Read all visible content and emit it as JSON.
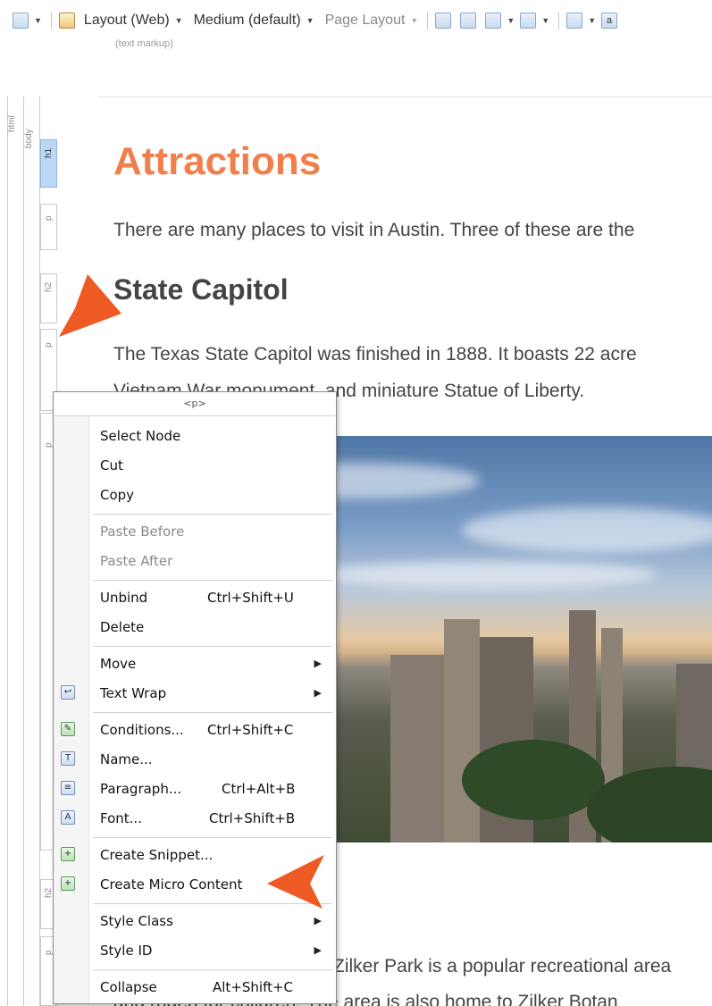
{
  "toolbar": {
    "layout_label": "Layout (Web)",
    "size_label": "Medium (default)",
    "page_layout_label": "Page Layout",
    "markup_note": "(text markup)",
    "icons": [
      "view-icon",
      "structure-icon",
      "preview-icon",
      "insert-table-icon",
      "insert-image-icon",
      "link-icon",
      "text-icon",
      "font-icon"
    ]
  },
  "structure": {
    "html_tag": "html",
    "body_tag": "body",
    "nodes": [
      {
        "label": "h1",
        "active": true
      },
      {
        "label": "p",
        "active": false
      },
      {
        "label": "h2",
        "active": false
      },
      {
        "label": "p",
        "active": false
      },
      {
        "label": "p",
        "active": false
      },
      {
        "label": "h2",
        "active": false
      },
      {
        "label": "p",
        "active": false
      }
    ]
  },
  "document": {
    "heading": "Attractions",
    "intro": "There are many places to visit in Austin. Three of these are the",
    "subheading": "State Capitol",
    "capitol_line1": "The Texas State Capitol was finished in 1888. It boasts 22 acre",
    "capitol_line2": "Vietnam War monument, and miniature Statue of Liberty.",
    "park_line1": "Zilker Park is a popular recreational area",
    "park_line2": "and rodeo for children. The area is also home to Zilker Botan"
  },
  "menu": {
    "title": "<p>",
    "items": [
      {
        "label": "Select Node",
        "shortcut": "",
        "enabled": true
      },
      {
        "label": "Cut",
        "shortcut": "",
        "enabled": true
      },
      {
        "label": "Copy",
        "shortcut": "",
        "enabled": true
      },
      {
        "label": "Paste Before",
        "shortcut": "",
        "enabled": false
      },
      {
        "label": "Paste After",
        "shortcut": "",
        "enabled": false
      },
      {
        "label": "Unbind",
        "shortcut": "Ctrl+Shift+U",
        "enabled": true
      },
      {
        "label": "Delete",
        "shortcut": "",
        "enabled": true
      },
      {
        "label": "Move",
        "shortcut": "",
        "enabled": true,
        "submenu": true
      },
      {
        "label": "Text Wrap",
        "shortcut": "",
        "enabled": true,
        "submenu": true,
        "icon": "text-wrap-icon"
      },
      {
        "label": "Conditions...",
        "shortcut": "Ctrl+Shift+C",
        "enabled": true,
        "icon": "conditions-icon"
      },
      {
        "label": "Name...",
        "shortcut": "",
        "enabled": true,
        "icon": "name-icon"
      },
      {
        "label": "Paragraph...",
        "shortcut": "Ctrl+Alt+B",
        "enabled": true,
        "icon": "paragraph-icon"
      },
      {
        "label": "Font...",
        "shortcut": "Ctrl+Shift+B",
        "enabled": true,
        "icon": "font-icon"
      },
      {
        "label": "Create Snippet...",
        "shortcut": "",
        "enabled": true,
        "icon": "snippet-icon"
      },
      {
        "label": "Create Micro Content",
        "shortcut": "",
        "enabled": true,
        "icon": "micro-content-icon"
      },
      {
        "label": "Style Class",
        "shortcut": "",
        "enabled": true,
        "submenu": true
      },
      {
        "label": "Style ID",
        "shortcut": "",
        "enabled": true,
        "submenu": true
      },
      {
        "label": "Collapse",
        "shortcut": "Alt+Shift+C",
        "enabled": true
      }
    ]
  },
  "colors": {
    "heading": "#f07f4b",
    "callout_arrow": "#ee5a24",
    "active_node": "#bcd7f3"
  }
}
